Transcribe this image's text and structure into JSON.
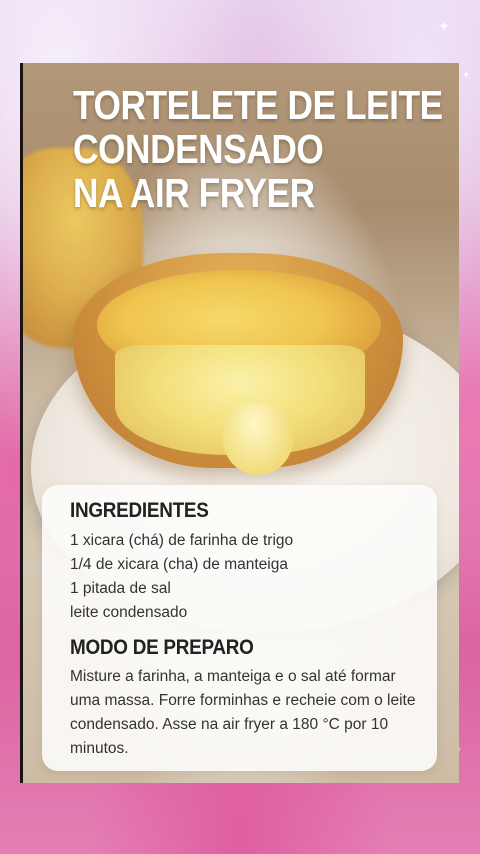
{
  "recipe": {
    "title_lines": [
      "TORTELETE DE LEITE",
      "CONDENSADO",
      "NA AIR FRYER"
    ],
    "ingredients_heading": "INGREDIENTES",
    "ingredients": [
      "1 xicara (chá) de farinha de trigo",
      "1/4 de xicara (cha) de manteiga",
      "1 pitada de sal",
      "leite condensado"
    ],
    "method_heading": "MODO DE PREPARO",
    "method_text": "Misture a farinha, a manteiga e o sal até formar uma massa. Forre forminhas e recheie com o leite condensado. Asse na air fryer a 180 °C por 10 minutos."
  },
  "theme": {
    "background_pink": "#e46aa8",
    "title_color": "#ffffff",
    "heading_color": "#222222"
  }
}
